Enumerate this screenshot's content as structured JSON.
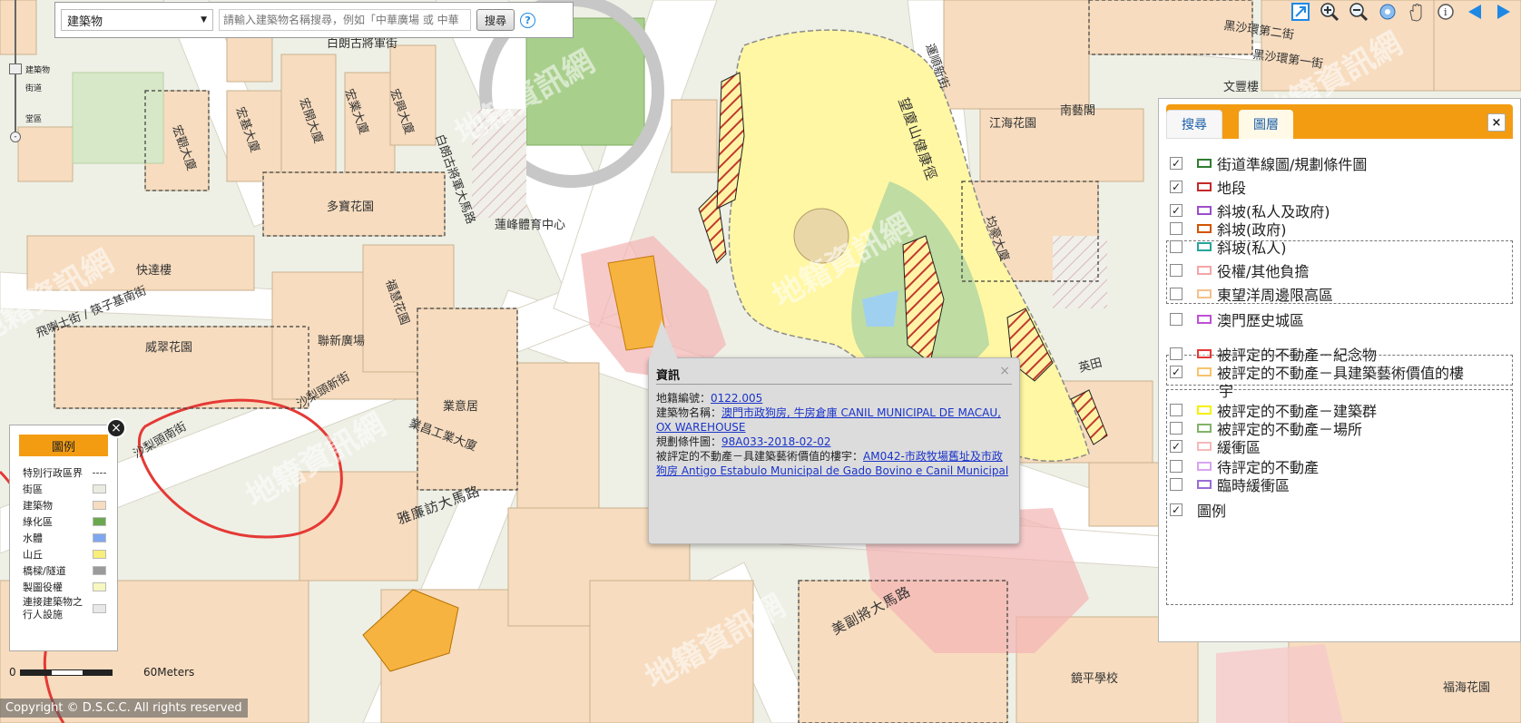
{
  "search": {
    "type_value": "建築物",
    "placeholder": "請輸入建築物名稱搜尋，例如「中華廣場 或 中華",
    "button": "搜尋",
    "help": "?"
  },
  "zoom": {
    "levels": [
      "建築物",
      "街道",
      "堂區"
    ],
    "top": "+",
    "bottom": "-"
  },
  "toolbar": {
    "icons": [
      "full-extent-icon",
      "zoom-in-icon",
      "zoom-out-icon",
      "identify-icon",
      "pan-hand-icon",
      "info-icon",
      "back-icon",
      "forward-icon"
    ]
  },
  "map": {
    "labels": [
      "黑沙環第二街",
      "黑沙環第一街",
      "文豐樓",
      "白朗古將軍街",
      "白朗古將軍大馬路",
      "宏觀大廈",
      "宏基大廈",
      "宏開大廈",
      "宏業大廈",
      "宏興大廈",
      "運順新街",
      "望廈山健康徑",
      "多寶花園",
      "蓮峰體育中心",
      "快達樓",
      "飛喇士街 / 筷子基南街",
      "威翠花園",
      "聯新廣場",
      "福慧花園",
      "沙梨頭新街",
      "沙梨頭南街",
      "業昌工業大廈",
      "業意居",
      "雅廉訪大馬路",
      "美副將大馬路",
      "鏡平學校",
      "福海花園",
      "江海花園",
      "南藝閣",
      "均豪大廈",
      "英田"
    ],
    "watermark": "地籍資訊網"
  },
  "popup": {
    "title": "資訊",
    "close": "×",
    "lot_label": "地籍編號：",
    "lot_value": "0122.005",
    "building_label": "建築物名稱：",
    "building_value": "澳門市政狗房, 牛房倉庫 CANIL MUNICIPAL DE MACAU, OX WAREHOUSE",
    "plan_label": "規劃條件圖：",
    "plan_value": "98A033-2018-02-02",
    "heritage_label": "被評定的不動產－具建築藝術價值的樓宇：",
    "heritage_value": "AM042-市政牧場舊址及市政狗房 Antigo Estabulo Municipal de Gado Bovino e Canil Municipal"
  },
  "panel": {
    "tab_search": "搜尋",
    "tab_layers": "圖層",
    "close": "×",
    "layers": [
      {
        "label": "街道準線圖/規劃條件圖",
        "checked": true,
        "color": "#2e7d32"
      },
      {
        "label": "地段",
        "checked": true,
        "color": "#c62828"
      },
      {
        "label": "斜坡(私人及政府)",
        "checked": true,
        "color": "#9c4dcc"
      },
      {
        "label": "斜坡(政府)",
        "checked": false,
        "color": "#d35400"
      },
      {
        "label": "斜坡(私人)",
        "checked": false,
        "color": "#26a69a"
      },
      {
        "label": "役權/其他負擔",
        "checked": false,
        "color": "#f4a6a6"
      },
      {
        "label": "東望洋周邊限高區",
        "checked": false,
        "color": "#f6c08a"
      },
      {
        "label": "澳門歷史城區",
        "checked": false,
        "color": "#c04fd6"
      },
      {
        "label": "被評定的不動產－紀念物",
        "checked": false,
        "color": "#e53935"
      },
      {
        "label": "被評定的不動產－具建築藝術價值的樓",
        "label2": "宇",
        "checked": true,
        "color": "#f9c36b"
      },
      {
        "label": "被評定的不動產－建築群",
        "checked": false,
        "color": "#f5f000"
      },
      {
        "label": "被評定的不動產－場所",
        "checked": false,
        "color": "#82b368"
      },
      {
        "label": "緩衝區",
        "checked": true,
        "color": "#f5b9b9"
      },
      {
        "label": "待評定的不動產",
        "checked": false,
        "color": "#d8a4f0"
      },
      {
        "label": "臨時緩衝區",
        "checked": false,
        "color": "#9a6cd6"
      },
      {
        "label": "圖例",
        "checked": true,
        "color": ""
      }
    ]
  },
  "legend": {
    "title": "圖例",
    "items": [
      {
        "label": "特別行政區界",
        "color": "#555"
      },
      {
        "label": "街區",
        "color": "#e9ece0"
      },
      {
        "label": "建築物",
        "color": "#f7dcbf"
      },
      {
        "label": "綠化區",
        "color": "#6aa84f"
      },
      {
        "label": "水體",
        "color": "#7fa7f0"
      },
      {
        "label": "山丘",
        "color": "#f7ef79"
      },
      {
        "label": "橋樑/隧道",
        "color": "#9a9a9a"
      },
      {
        "label": "製圖役權",
        "color": "#f7f7c0"
      },
      {
        "label": "連接建築物之行人設施",
        "color": "#e8e8e8"
      }
    ],
    "close": "×"
  },
  "scale": {
    "zero": "0",
    "end": "60Meters"
  },
  "copyright": "Copyright © D.S.C.C. All rights reserved"
}
